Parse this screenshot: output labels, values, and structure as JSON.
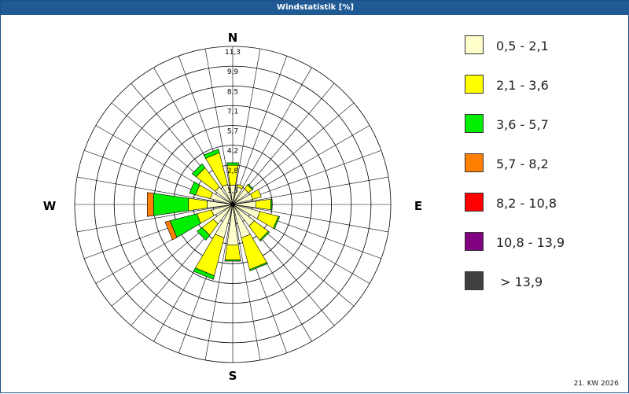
{
  "window": {
    "title": "Windstatistik [%]"
  },
  "footer": {
    "week": "21. KW 2026"
  },
  "chart_data": {
    "type": "windrose",
    "title": "Windstatistik [%]",
    "unit": "%",
    "directions": [
      "N",
      "NNE",
      "NE",
      "ENE",
      "E",
      "ESE",
      "SE",
      "SSE",
      "S",
      "SSW",
      "SW",
      "WSW",
      "W",
      "WNW",
      "NW",
      "NNW"
    ],
    "direction_labels": {
      "N": "N",
      "E": "E",
      "S": "S",
      "W": "W"
    },
    "radial_ticks": [
      "1,3",
      "2,8",
      "4,2",
      "5,7",
      "7,1",
      "8,5",
      "9,9",
      "11,3"
    ],
    "rmax": 11.3,
    "series": [
      {
        "name": "0,5 - 2,1",
        "color": "#ffffcc",
        "values": [
          0.3,
          0.2,
          0.3,
          0.4,
          0.6,
          1.0,
          0.9,
          1.5,
          2.0,
          1.5,
          0.7,
          0.5,
          0.8,
          0.6,
          0.5,
          0.4
        ]
      },
      {
        "name": "2,1 - 3,6",
        "color": "#ffff00",
        "values": [
          1.6,
          0.2,
          0.4,
          0.7,
          1.2,
          1.5,
          1.4,
          2.6,
          1.2,
          3.1,
          1.1,
          1.2,
          1.5,
          1.2,
          1.9,
          2.6
        ]
      },
      {
        "name": "3,6 - 5,7",
        "color": "#00ee00",
        "values": [
          0.2,
          0.0,
          0.1,
          0.0,
          0.1,
          0.1,
          0.1,
          0.1,
          0.1,
          0.3,
          0.5,
          2.2,
          2.8,
          0.5,
          0.4,
          0.3
        ]
      },
      {
        "name": "5,7 - 8,2",
        "color": "#ff8000",
        "values": [
          0.0,
          0.0,
          0.0,
          0.0,
          0.0,
          0.0,
          0.0,
          0.0,
          0.0,
          0.0,
          0.0,
          0.4,
          0.5,
          0.0,
          0.0,
          0.0
        ]
      },
      {
        "name": "8,2 - 10,8",
        "color": "#ff0000",
        "values": [
          0,
          0,
          0,
          0,
          0,
          0,
          0,
          0,
          0,
          0,
          0,
          0,
          0,
          0,
          0,
          0
        ]
      },
      {
        "name": "10,8 - 13,9",
        "color": "#800080",
        "values": [
          0,
          0,
          0,
          0,
          0,
          0,
          0,
          0,
          0,
          0,
          0,
          0,
          0,
          0,
          0,
          0
        ]
      },
      {
        "name": " > 13,9",
        "color": "#404040",
        "values": [
          0,
          0,
          0,
          0,
          0,
          0,
          0,
          0,
          0,
          0,
          0,
          0,
          0,
          0,
          0,
          0
        ]
      }
    ],
    "grid": true,
    "legend_position": "right"
  }
}
